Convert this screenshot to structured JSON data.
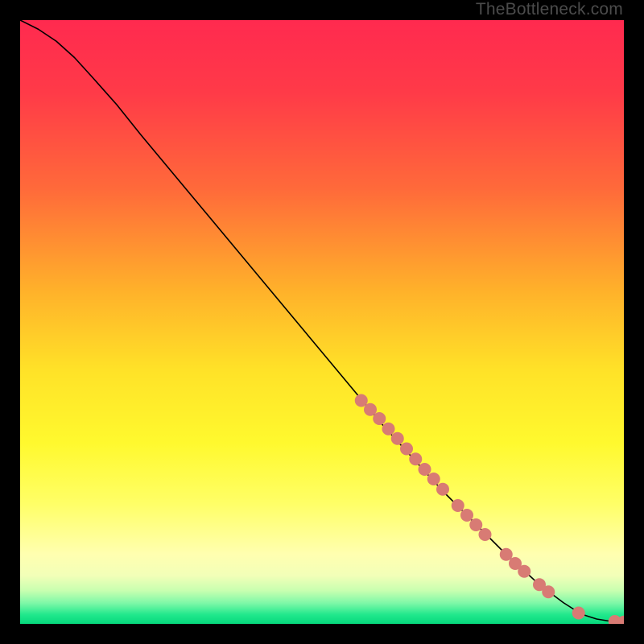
{
  "watermark": "TheBottleneck.com",
  "chart_data": {
    "type": "line",
    "title": "",
    "xlabel": "",
    "ylabel": "",
    "xlim": [
      0,
      100
    ],
    "ylim": [
      0,
      100
    ],
    "background_gradient_stops": [
      {
        "offset": 0.0,
        "color": "#ff2a4f"
      },
      {
        "offset": 0.12,
        "color": "#ff3a48"
      },
      {
        "offset": 0.28,
        "color": "#ff6a3a"
      },
      {
        "offset": 0.45,
        "color": "#ffb22a"
      },
      {
        "offset": 0.58,
        "color": "#ffe228"
      },
      {
        "offset": 0.7,
        "color": "#fff92e"
      },
      {
        "offset": 0.8,
        "color": "#ffff66"
      },
      {
        "offset": 0.885,
        "color": "#ffffb0"
      },
      {
        "offset": 0.92,
        "color": "#f2ffb8"
      },
      {
        "offset": 0.945,
        "color": "#c8ffb0"
      },
      {
        "offset": 0.965,
        "color": "#80f8a8"
      },
      {
        "offset": 0.985,
        "color": "#20e88c"
      },
      {
        "offset": 1.0,
        "color": "#06d87c"
      }
    ],
    "series": [
      {
        "name": "bottleneck-curve",
        "type": "line",
        "stroke": "#000000",
        "stroke_width": 1.6,
        "points": [
          {
            "x": 0.0,
            "y": 100.0
          },
          {
            "x": 3.0,
            "y": 98.5
          },
          {
            "x": 6.0,
            "y": 96.5
          },
          {
            "x": 9.0,
            "y": 93.8
          },
          {
            "x": 12.0,
            "y": 90.5
          },
          {
            "x": 16.0,
            "y": 86.0
          },
          {
            "x": 20.0,
            "y": 81.0
          },
          {
            "x": 30.0,
            "y": 69.0
          },
          {
            "x": 40.0,
            "y": 57.0
          },
          {
            "x": 50.0,
            "y": 45.0
          },
          {
            "x": 60.0,
            "y": 33.0
          },
          {
            "x": 70.0,
            "y": 22.0
          },
          {
            "x": 80.0,
            "y": 12.0
          },
          {
            "x": 86.0,
            "y": 6.5
          },
          {
            "x": 90.0,
            "y": 3.5
          },
          {
            "x": 93.0,
            "y": 1.6
          },
          {
            "x": 95.5,
            "y": 0.8
          },
          {
            "x": 98.0,
            "y": 0.4
          },
          {
            "x": 100.0,
            "y": 0.3
          }
        ]
      },
      {
        "name": "highlighted-points",
        "type": "scatter",
        "fill": "#d87b74",
        "radius": 8,
        "points": [
          {
            "x": 56.5,
            "y": 37.0
          },
          {
            "x": 58.0,
            "y": 35.5
          },
          {
            "x": 59.5,
            "y": 34.0
          },
          {
            "x": 61.0,
            "y": 32.3
          },
          {
            "x": 62.5,
            "y": 30.7
          },
          {
            "x": 64.0,
            "y": 29.0
          },
          {
            "x": 65.5,
            "y": 27.3
          },
          {
            "x": 67.0,
            "y": 25.6
          },
          {
            "x": 68.5,
            "y": 24.0
          },
          {
            "x": 70.0,
            "y": 22.3
          },
          {
            "x": 72.5,
            "y": 19.6
          },
          {
            "x": 74.0,
            "y": 18.0
          },
          {
            "x": 75.5,
            "y": 16.4
          },
          {
            "x": 77.0,
            "y": 14.8
          },
          {
            "x": 80.5,
            "y": 11.5
          },
          {
            "x": 82.0,
            "y": 10.0
          },
          {
            "x": 83.5,
            "y": 8.7
          },
          {
            "x": 86.0,
            "y": 6.5
          },
          {
            "x": 87.5,
            "y": 5.3
          },
          {
            "x": 92.5,
            "y": 1.8
          },
          {
            "x": 98.5,
            "y": 0.4
          },
          {
            "x": 100.0,
            "y": 0.3
          }
        ]
      }
    ]
  }
}
